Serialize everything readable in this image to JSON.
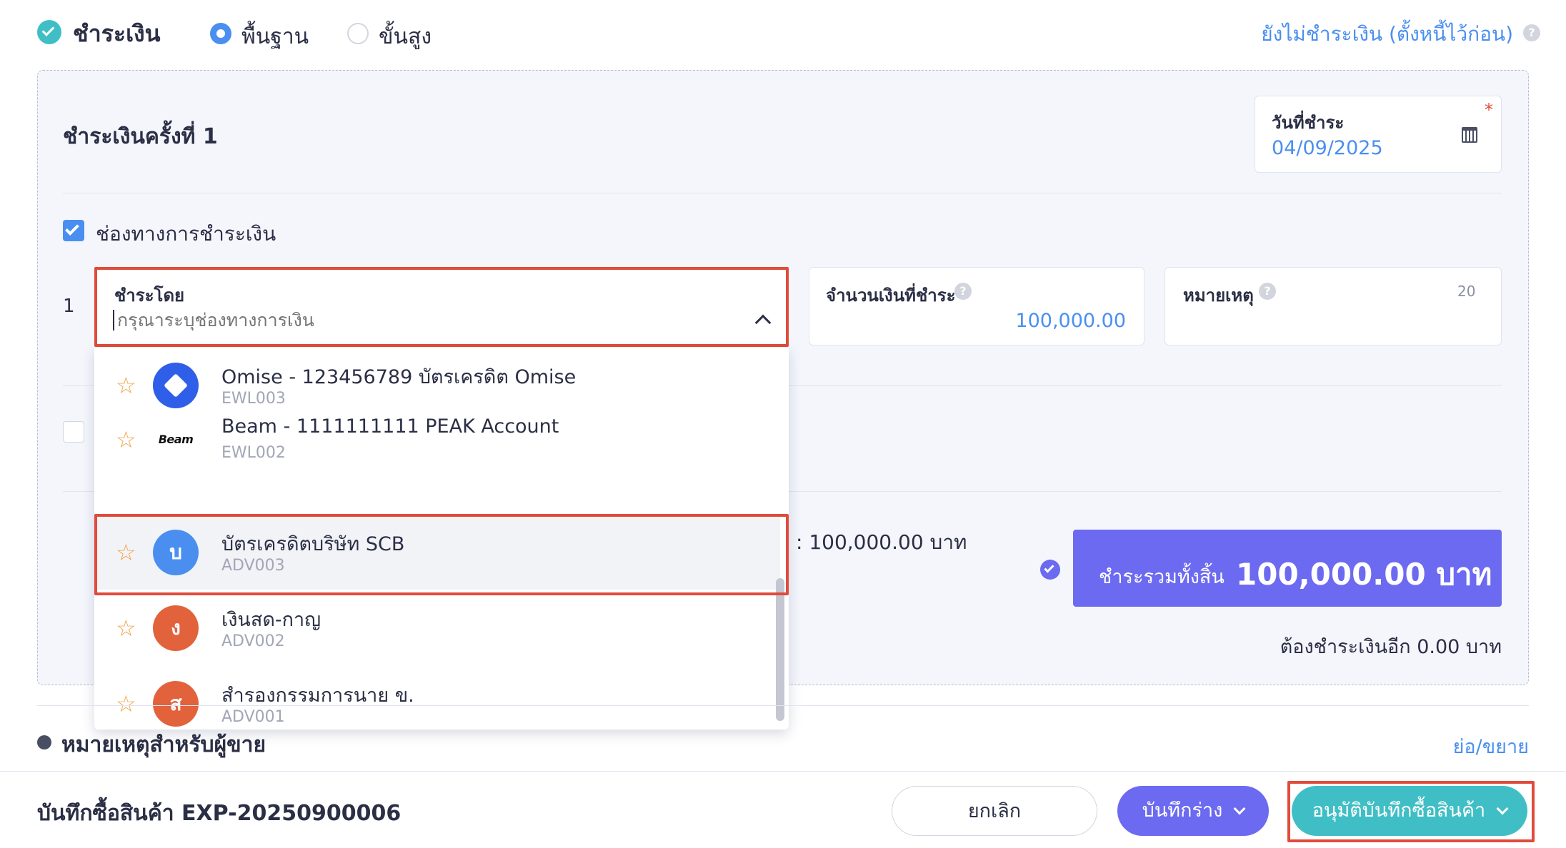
{
  "payment": {
    "title": "ชำระเงิน",
    "mode_basic": "พื้นฐาน",
    "mode_advanced": "ขั้นสูง",
    "mode_selected": "basic",
    "unpaid_link": "ยังไม่ชำระเงิน (ตั้งหนี้ไว้ก่อน)",
    "help_glyph": "?"
  },
  "panel": {
    "section_title": "ชำระเงินครั้งที่ 1",
    "date_label": "วันที่ชำระ",
    "date_value": "04/09/2025",
    "required_mark": "*",
    "channel_checkbox_label": "ช่องทางการชำระเงิน",
    "channel_checked": true,
    "row_number": "1",
    "payby_label": "ชำระโดย",
    "payby_placeholder": "กรุณาระบุช่องทางการเงิน",
    "amount_label": "จำนวนเงินที่ชำระ",
    "amount_value": "100,000.00",
    "note_label": "หมายเหตุ",
    "note_counter": "20",
    "second_checkbox_checked": false,
    "partial_amount": ":  100,000.00 บาท",
    "total_label": "ชำระรวมทั้งสิ้น",
    "total_value": "100,000.00 บาท",
    "remaining_text": "ต้องชำระเงินอีก 0.00 บาท"
  },
  "dropdown": {
    "items": [
      {
        "name": "Omise - 123456789 บัตรเครดิต Omise",
        "code": "EWL003",
        "avatar": "",
        "avatar_type": "omise"
      },
      {
        "name": "Beam - 1111111111 PEAK Account",
        "code": "EWL002",
        "avatar": "Beam",
        "avatar_type": "beam"
      },
      {
        "name": "บัตรเครดิตบริษัท SCB",
        "code": "ADV003",
        "avatar": "บ",
        "avatar_type": "letter",
        "color": "#4a8ff0",
        "selected": true
      },
      {
        "name": "เงินสด-กาญ",
        "code": "ADV002",
        "avatar": "ง",
        "avatar_type": "letter",
        "color": "#e2623c"
      },
      {
        "name": "สำรองกรรมการนาย ข.",
        "code": "ADV001",
        "avatar": "ส",
        "avatar_type": "letter",
        "color": "#e2623c"
      }
    ],
    "star_glyph": "☆"
  },
  "seller_note": {
    "title": "หมายเหตุสำหรับผู้ขาย",
    "toggle": "ย่อ/ขยาย"
  },
  "footer": {
    "doc_title": "บันทึกซื้อสินค้า EXP-20250900006",
    "cancel_label": "ยกเลิก",
    "draft_label": "บันทึกร่าง",
    "approve_label": "อนุมัติบันทึกซื้อสินค้า"
  },
  "colors": {
    "accent_teal": "#3fbfc5",
    "accent_purple": "#6c6af0",
    "link_blue": "#4a8ff0",
    "highlight_red": "#e14b3b"
  }
}
